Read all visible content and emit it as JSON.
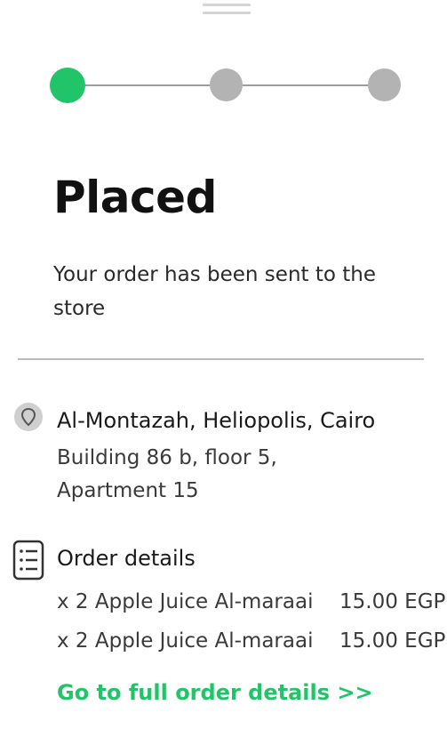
{
  "status": {
    "title": "Placed",
    "description": "Your order has been sent to the store",
    "current_step": 1,
    "total_steps": 3
  },
  "address": {
    "title": "Al-Montazah, Heliopolis, Cairo",
    "line1": "Building 86 b, floor 5,",
    "line2": "Apartment 15"
  },
  "order": {
    "title": "Order details",
    "items": [
      {
        "name": "x 2 Apple Juice Al-maraai",
        "price": "15.00 EGP"
      },
      {
        "name": "x 2 Apple Juice Al-maraai",
        "price": "15.00 EGP"
      }
    ],
    "full_details_link": "Go to full order details >>"
  },
  "colors": {
    "accent": "#22c46a",
    "inactive_step": "#b3b3b3",
    "step_line": "#9e9e9e",
    "divider": "#bdbdbd"
  },
  "icons": {
    "address": "location-pin-icon",
    "order": "order-list-icon"
  }
}
